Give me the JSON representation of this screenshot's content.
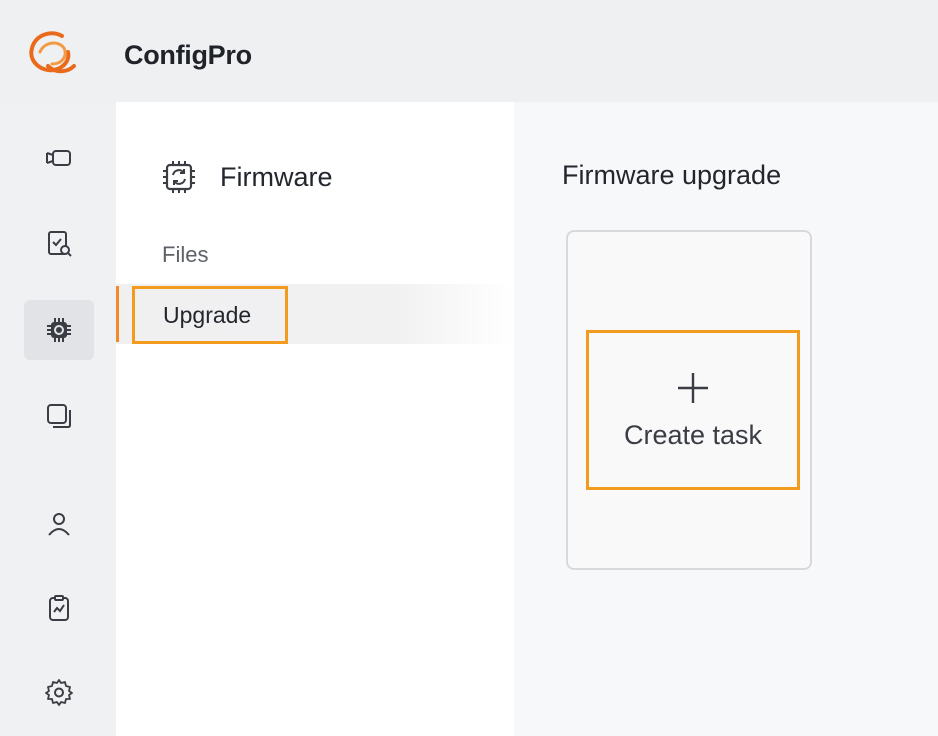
{
  "app": {
    "title": "ConfigPro",
    "logo_icon": "configpro-logo-icon",
    "brand_color": "#ea6a1c"
  },
  "rail": {
    "items": [
      {
        "icon": "camera-device-icon",
        "active": false
      },
      {
        "icon": "device-search-icon",
        "active": false
      },
      {
        "icon": "firmware-chip-icon",
        "active": true
      },
      {
        "icon": "copy-layers-icon",
        "active": false
      },
      {
        "icon": "user-icon",
        "active": false
      },
      {
        "icon": "clipboard-report-icon",
        "active": false
      },
      {
        "icon": "settings-gear-icon",
        "active": false
      }
    ]
  },
  "submenu": {
    "header_icon": "firmware-sync-chip-icon",
    "title": "Firmware",
    "items": [
      {
        "label": "Files",
        "active": false
      },
      {
        "label": "Upgrade",
        "active": true
      }
    ]
  },
  "content": {
    "title": "Firmware upgrade",
    "create_task": {
      "icon": "plus-icon",
      "label": "Create task"
    }
  },
  "colors": {
    "highlight": "#f39b1d",
    "active_indicator": "#f08a2a"
  }
}
